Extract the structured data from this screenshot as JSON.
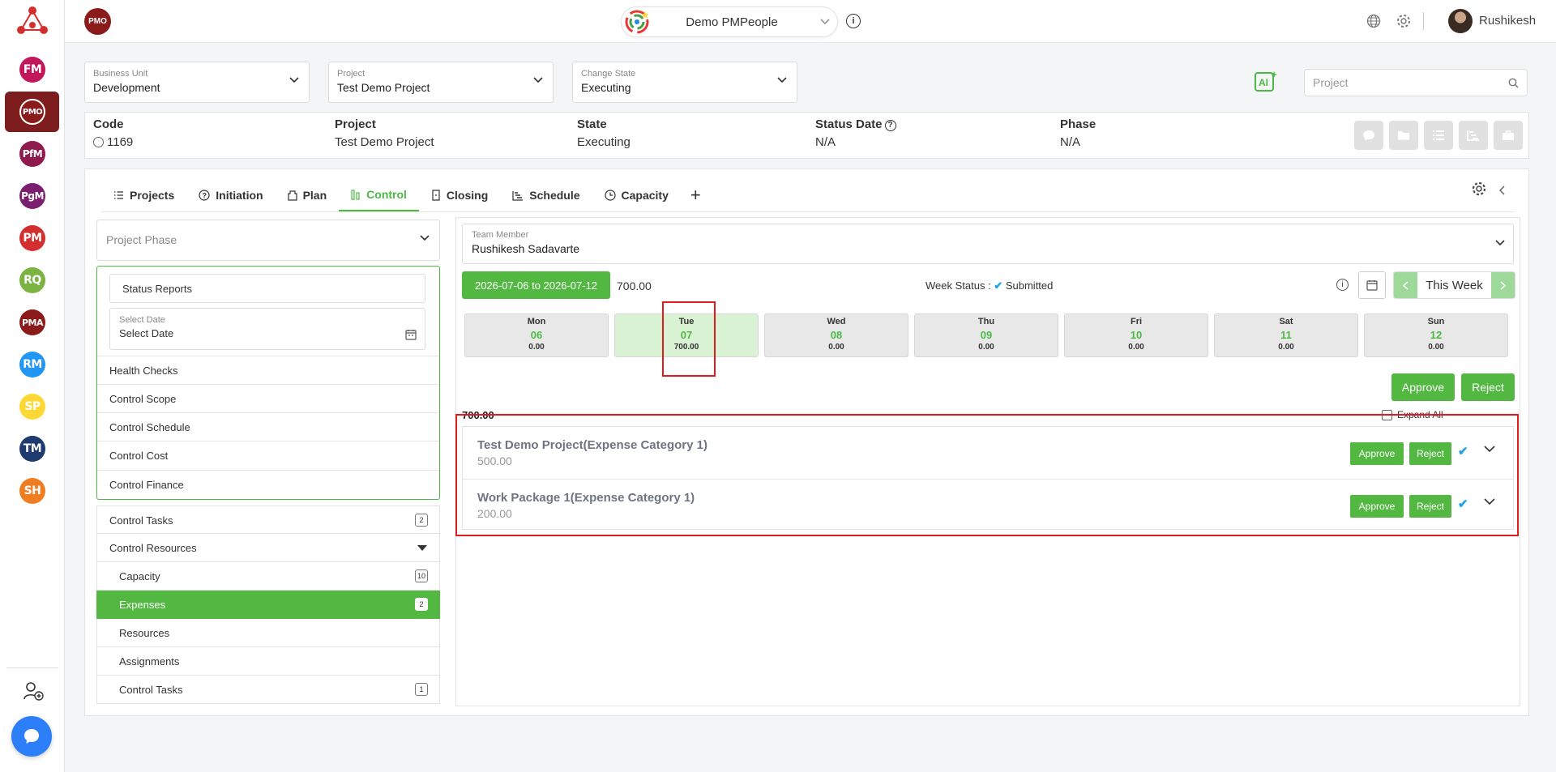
{
  "sidebar": {
    "items": [
      {
        "label": "FM",
        "color": "#c2185b"
      },
      {
        "label": "PMO",
        "color": "#8b1a1a"
      },
      {
        "label": "PfM",
        "color": "#8e1a4e"
      },
      {
        "label": "PgM",
        "color": "#7b1f6e"
      },
      {
        "label": "PM",
        "color": "#d32f2f"
      },
      {
        "label": "RQ",
        "color": "#7cb342"
      },
      {
        "label": "PMA",
        "color": "#8b1a1a"
      },
      {
        "label": "RM",
        "color": "#2196f3"
      },
      {
        "label": "SP",
        "color": "#fdd835"
      },
      {
        "label": "TM",
        "color": "#1e3a6e"
      },
      {
        "label": "SH",
        "color": "#ef7d22"
      }
    ]
  },
  "topbar": {
    "badge": "PMO",
    "org_name": "Demo PMPeople",
    "user_name": "Rushikesh"
  },
  "filters": {
    "business_unit": {
      "label": "Business Unit",
      "value": "Development"
    },
    "project": {
      "label": "Project",
      "value": "Test Demo Project"
    },
    "change_state": {
      "label": "Change State",
      "value": "Executing"
    },
    "search_placeholder": "Project"
  },
  "info": {
    "code_label": "Code",
    "code_value": "1169",
    "project_label": "Project",
    "project_value": "Test Demo Project",
    "state_label": "State",
    "state_value": "Executing",
    "status_date_label": "Status Date",
    "status_date_value": "N/A",
    "phase_label": "Phase",
    "phase_value": "N/A"
  },
  "tabs": [
    {
      "label": "Projects",
      "icon": "list-icon"
    },
    {
      "label": "Initiation",
      "icon": "help-circle-icon"
    },
    {
      "label": "Plan",
      "icon": "plan-icon"
    },
    {
      "label": "Control",
      "icon": "control-icon"
    },
    {
      "label": "Closing",
      "icon": "closing-icon"
    },
    {
      "label": "Schedule",
      "icon": "schedule-icon"
    },
    {
      "label": "Capacity",
      "icon": "clock-icon"
    }
  ],
  "left": {
    "phase_placeholder": "Project Phase",
    "status_reports": "Status Reports",
    "select_date_label": "Select Date",
    "select_date_value": "Select Date",
    "group_items": [
      "Health Checks",
      "Control Scope",
      "Control Schedule",
      "Control Cost",
      "Control Finance"
    ],
    "nav": {
      "control_tasks": {
        "label": "Control Tasks",
        "count": "2"
      },
      "control_resources": {
        "label": "Control Resources"
      },
      "capacity": {
        "label": "Capacity",
        "count": "10"
      },
      "expenses": {
        "label": "Expenses",
        "count": "2"
      },
      "resources": {
        "label": "Resources"
      },
      "assignments": {
        "label": "Assignments"
      },
      "control_tasks_sub": {
        "label": "Control Tasks",
        "count": "1"
      }
    }
  },
  "right": {
    "team_member_label": "Team Member",
    "team_member_value": "Rushikesh Sadavarte",
    "week_range": "2026-07-06 to 2026-07-12",
    "week_total": "700.00",
    "week_status_label": "Week Status :",
    "week_status_value": "Submitted",
    "this_week": "This Week",
    "days": [
      {
        "name": "Mon",
        "date": "06",
        "value": "0.00"
      },
      {
        "name": "Tue",
        "date": "07",
        "value": "700.00"
      },
      {
        "name": "Wed",
        "date": "08",
        "value": "0.00"
      },
      {
        "name": "Thu",
        "date": "09",
        "value": "0.00"
      },
      {
        "name": "Fri",
        "date": "10",
        "value": "0.00"
      },
      {
        "name": "Sat",
        "date": "11",
        "value": "0.00"
      },
      {
        "name": "Sun",
        "date": "12",
        "value": "0.00"
      }
    ],
    "approve_label": "Approve",
    "reject_label": "Reject",
    "total": "700.00",
    "expand_all": "Expand All",
    "expenses": [
      {
        "title": "Test Demo Project(Expense Category 1)",
        "amount": "500.00",
        "approve": "Approve",
        "reject": "Reject"
      },
      {
        "title": "Work Package 1(Expense Category 1)",
        "amount": "200.00",
        "approve": "Approve",
        "reject": "Reject"
      }
    ]
  }
}
